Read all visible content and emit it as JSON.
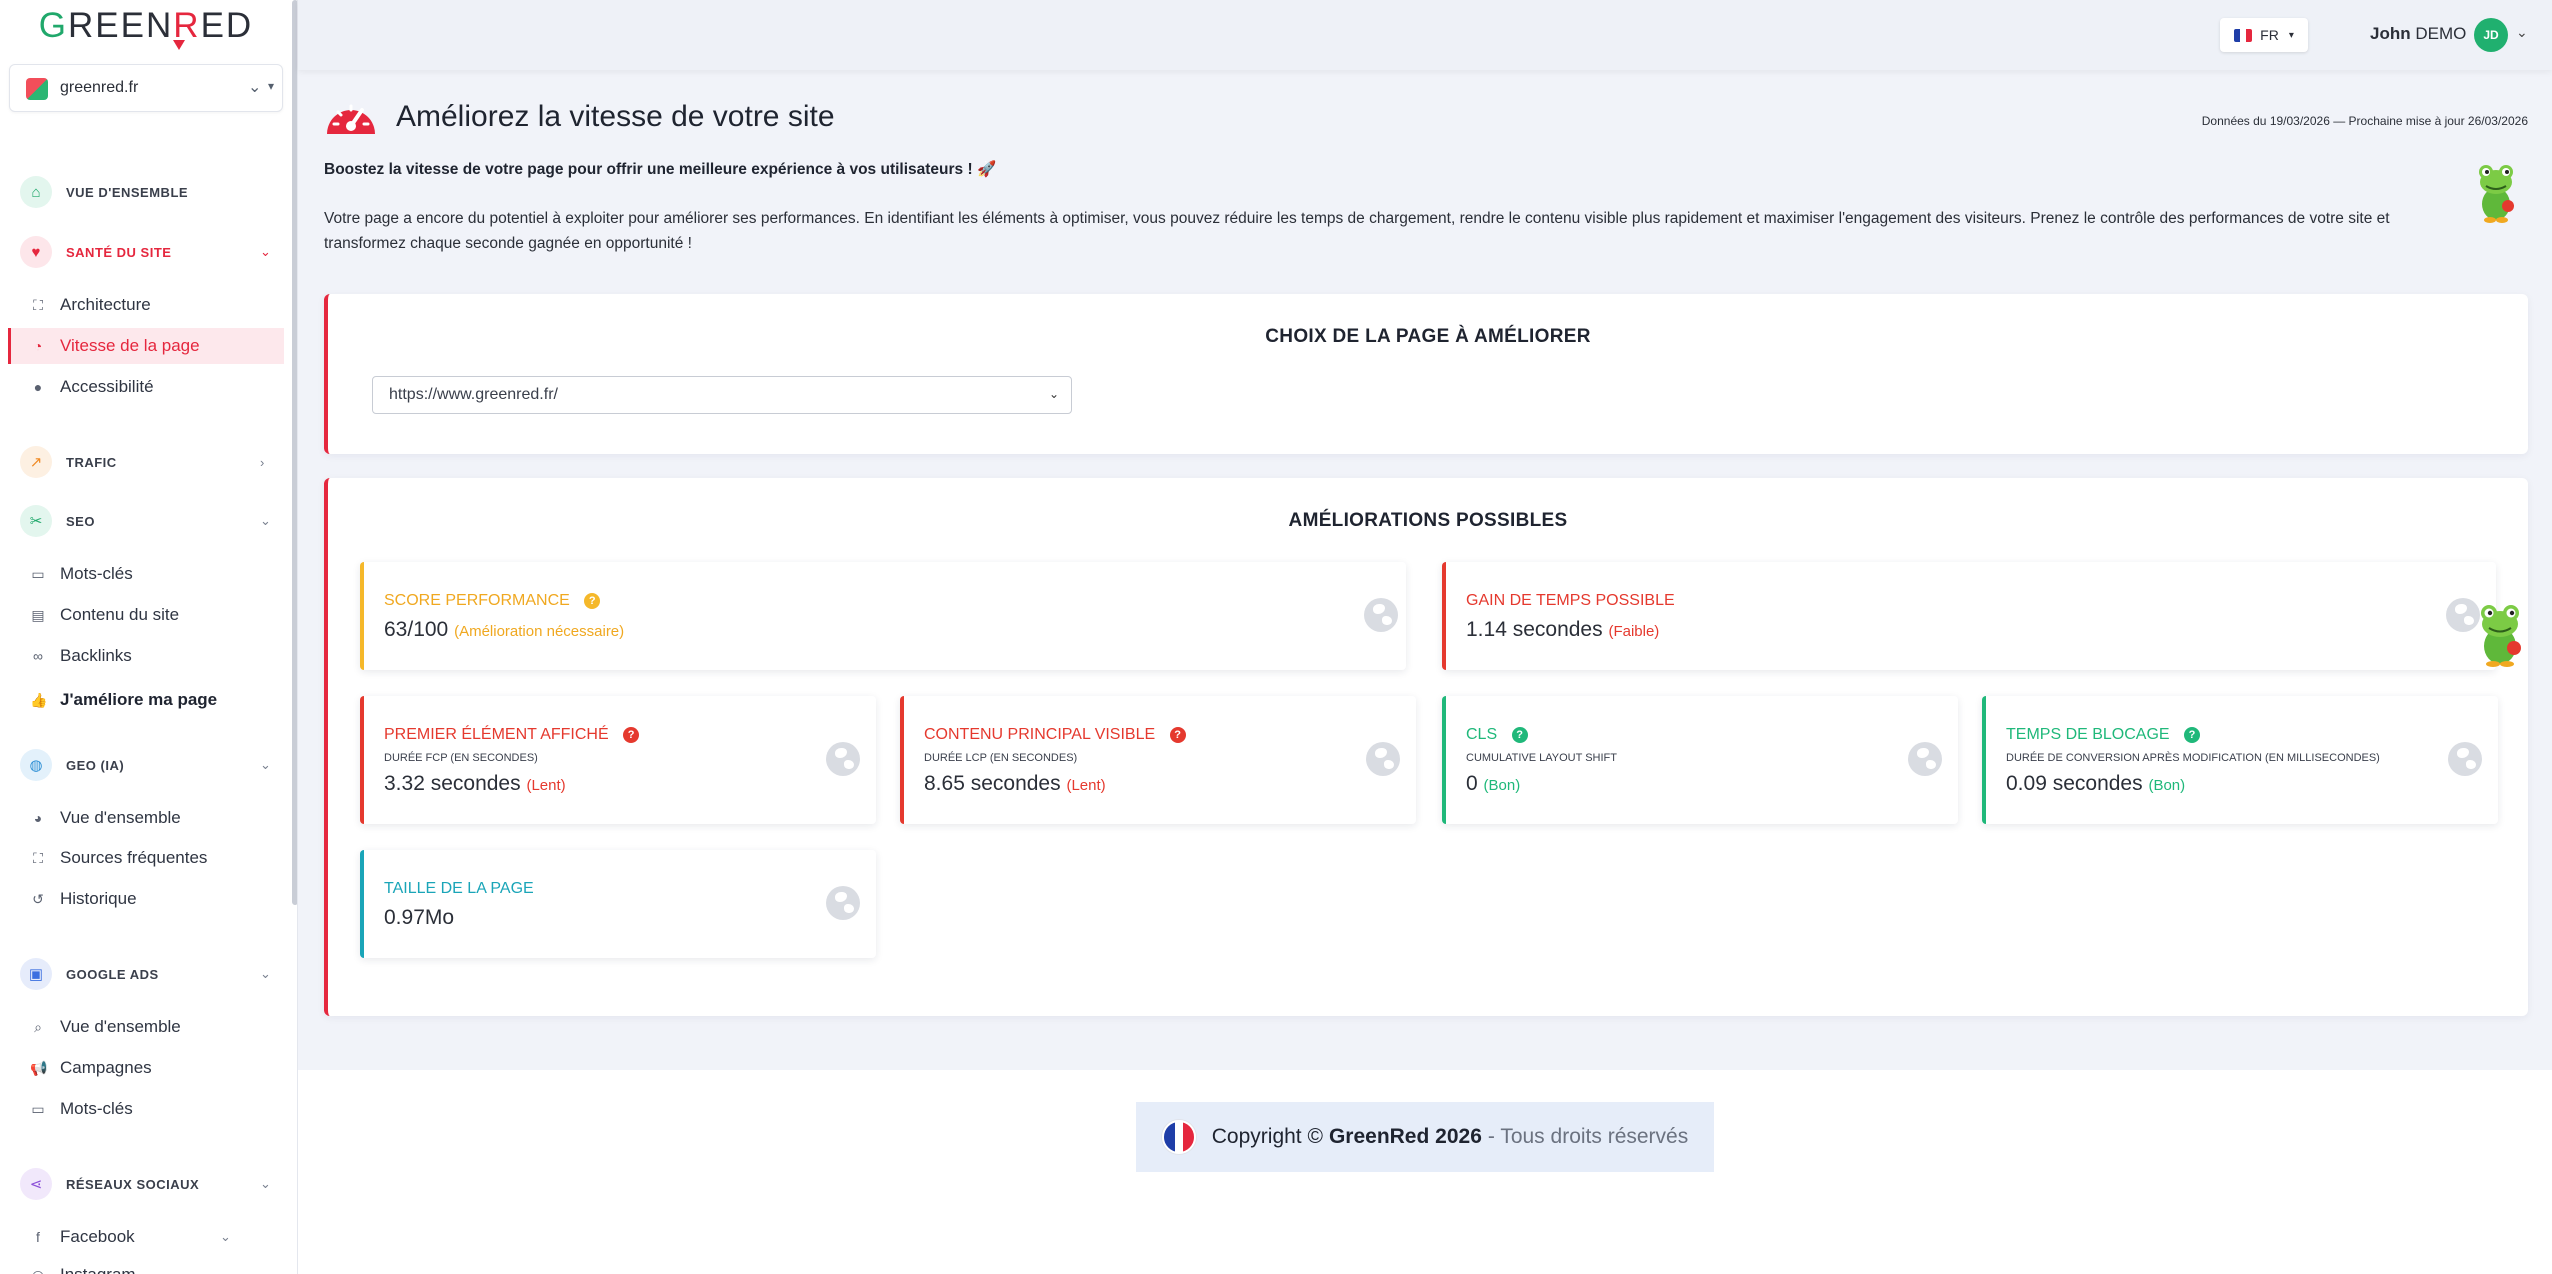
{
  "brand": {
    "logo_text": "GREENRED"
  },
  "site_selector": {
    "value": "greenred.fr"
  },
  "sidebar": {
    "sections": {
      "overview": "VUE D'ENSEMBLE",
      "site_health": "SANTÉ DU SITE",
      "traffic": "TRAFIC",
      "seo": "SEO",
      "geo": "GEO (IA)",
      "google_ads": "GOOGLE ADS",
      "social": "RÉSEAUX SOCIAUX"
    },
    "health_items": [
      "Architecture",
      "Vitesse de la page",
      "Accessibilité"
    ],
    "seo_items": [
      "Mots-clés",
      "Contenu du site",
      "Backlinks",
      "J'améliore ma page"
    ],
    "geo_items": [
      "Vue d'ensemble",
      "Sources fréquentes",
      "Historique"
    ],
    "ads_items": [
      "Vue d'ensemble",
      "Campagnes",
      "Mots-clés"
    ],
    "social_items": [
      "Facebook",
      "Instagram"
    ]
  },
  "topbar": {
    "language": "FR",
    "user_first": "John",
    "user_last": "DEMO",
    "avatar_initials": "JD"
  },
  "page": {
    "title": "Améliorez la vitesse de votre site",
    "dates": "Données du 19/03/2026 — Prochaine mise à jour 26/03/2026",
    "intro_bold": "Boostez la vitesse de votre page pour offrir une meilleure expérience à vos utilisateurs ! 🚀",
    "intro_text": "Votre page a encore du potentiel à exploiter pour améliorer ses performances. En identifiant les éléments à optimiser, vous pouvez réduire les temps de chargement, rendre le contenu visible plus rapidement et maximiser l'engagement des visiteurs. Prenez le contrôle des performances de votre site et transformez chaque seconde gagnée en opportunité !"
  },
  "page_choice": {
    "title": "CHOIX DE LA PAGE À AMÉLIORER",
    "selected_url": "https://www.greenred.fr/"
  },
  "improvements": {
    "title": "AMÉLIORATIONS POSSIBLES",
    "score": {
      "label": "SCORE PERFORMANCE",
      "value": "63/100",
      "note": "(Amélioration nécessaire)"
    },
    "gain": {
      "label": "GAIN DE TEMPS POSSIBLE",
      "value": "1.14 secondes",
      "note": "(Faible)"
    },
    "fcp": {
      "label": "PREMIER ÉLÉMENT AFFICHÉ",
      "sub": "DURÉE FCP (EN SECONDES)",
      "value": "3.32 secondes",
      "note": "(Lent)"
    },
    "lcp": {
      "label": "CONTENU PRINCIPAL VISIBLE",
      "sub": "DURÉE LCP (EN SECONDES)",
      "value": "8.65 secondes",
      "note": "(Lent)"
    },
    "cls": {
      "label": "CLS",
      "sub": "CUMULATIVE LAYOUT SHIFT",
      "value": "0",
      "note": "(Bon)"
    },
    "tbt": {
      "label": "TEMPS DE BLOCAGE",
      "sub": "DURÉE DE CONVERSION APRÈS MODIFICATION (EN MILLISECONDES)",
      "value": "0.09 secondes",
      "note": "(Bon)"
    },
    "size": {
      "label": "TAILLE DE LA PAGE",
      "value": "0.97Mo"
    }
  },
  "footer": {
    "copyright": "Copyright ©",
    "brand_year": "GreenRed 2026",
    "rights": "- Tous droits réservés"
  },
  "colors": {
    "brand_red": "#e5273e",
    "brand_green": "#20a86b",
    "warning": "#f5b82a",
    "good": "#20b87a",
    "info": "#1aa5b8"
  }
}
